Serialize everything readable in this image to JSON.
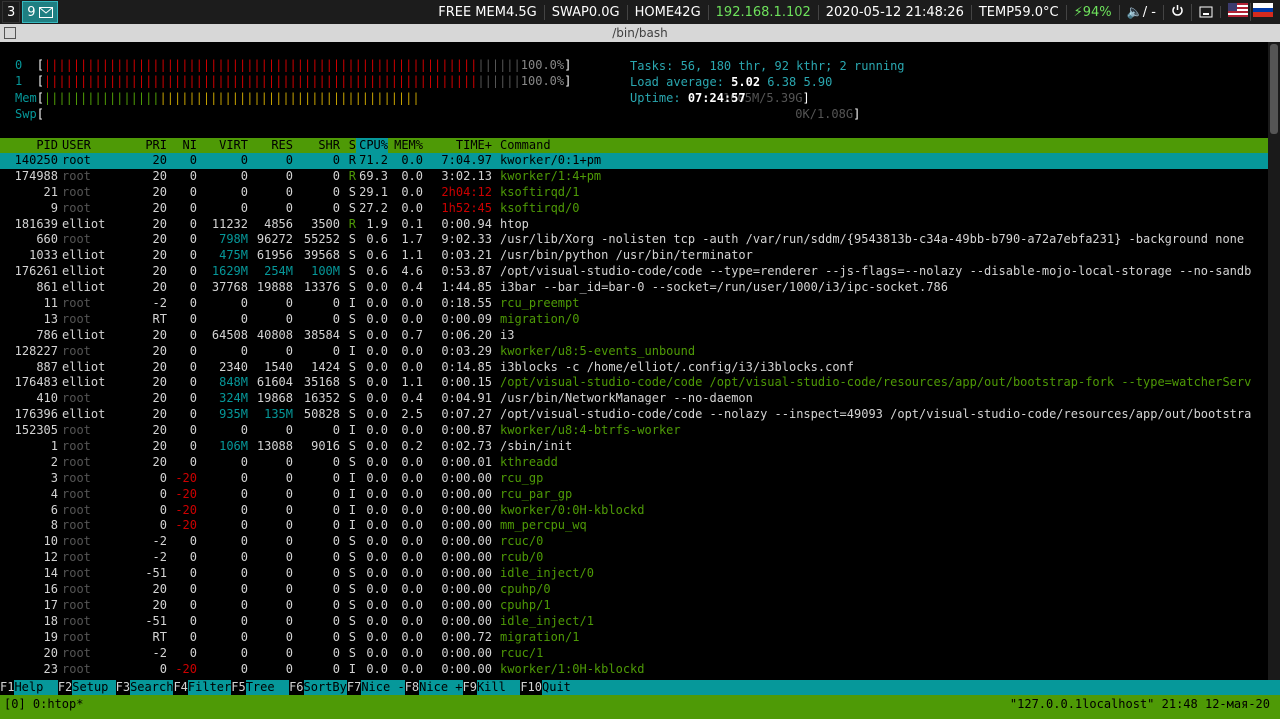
{
  "topbar": {
    "workspaces": [
      {
        "label": "3",
        "active": false
      },
      {
        "label": "9",
        "active": true
      }
    ],
    "blocks": {
      "freemem": "FREE MEM4.5G",
      "swap": "SWAP0.0G",
      "home": "HOME42G",
      "ip": "192.168.1.102",
      "datetime": "2020-05-12 21:48:26",
      "temp": "TEMP59.0°C",
      "battery": "⚡94%",
      "volume": "🔈/ -"
    },
    "colors": {
      "ip": "#6ee25c",
      "battery": "#6ee25c"
    }
  },
  "terminal": {
    "title": "/bin/bash"
  },
  "meters": {
    "cpu0": {
      "label": "0",
      "value": "100.0%"
    },
    "cpu1": {
      "label": "1",
      "value": "100.0%"
    },
    "mem": {
      "label": "Mem",
      "value": "1005M/5.39G"
    },
    "swp": {
      "label": "Swp",
      "value": "0K/1.08G"
    }
  },
  "info": {
    "tasks": "Tasks: 56, 180 thr, 92 kthr; 2 running",
    "load_label": "Load average:",
    "load1": "5.02",
    "load5": "6.38",
    "load15": "5.90",
    "uptime_label": "Uptime:",
    "uptime": "07:24:57"
  },
  "table": {
    "headers": [
      "PID",
      "USER",
      "PRI",
      "NI",
      "VIRT",
      "RES",
      "SHR",
      "S",
      "CPU%",
      "MEM%",
      "TIME+",
      "Command"
    ],
    "rows": [
      {
        "pid": "140250",
        "user": "root",
        "pri": "20",
        "ni": "0",
        "virt": "0",
        "res": "0",
        "shr": "0",
        "s": "R",
        "cpu": "71.2",
        "mem": "0.0",
        "time": "7:04.97",
        "cmd": "kworker/0:1+pm",
        "sel": true,
        "k": true
      },
      {
        "pid": "174988",
        "user": "root",
        "pri": "20",
        "ni": "0",
        "virt": "0",
        "res": "0",
        "shr": "0",
        "s": "R",
        "cpu": "69.3",
        "mem": "0.0",
        "time": "3:02.13",
        "cmd": "kworker/1:4+pm",
        "k": true
      },
      {
        "pid": "21",
        "user": "root",
        "pri": "20",
        "ni": "0",
        "virt": "0",
        "res": "0",
        "shr": "0",
        "s": "S",
        "cpu": "29.1",
        "mem": "0.0",
        "time": "2h04:12",
        "cmd": "ksoftirqd/1",
        "k": true
      },
      {
        "pid": "9",
        "user": "root",
        "pri": "20",
        "ni": "0",
        "virt": "0",
        "res": "0",
        "shr": "0",
        "s": "S",
        "cpu": "27.2",
        "mem": "0.0",
        "time": "1h52:45",
        "cmd": "ksoftirqd/0",
        "k": true
      },
      {
        "pid": "181639",
        "user": "elliot",
        "pri": "20",
        "ni": "0",
        "virt": "11232",
        "res": "4856",
        "shr": "3500",
        "s": "R",
        "cpu": "1.9",
        "mem": "0.1",
        "time": "0:00.94",
        "cmd": "htop"
      },
      {
        "pid": "660",
        "user": "root",
        "pri": "20",
        "ni": "0",
        "virt": "798M",
        "res": "96272",
        "shr": "55252",
        "s": "S",
        "cpu": "0.6",
        "mem": "1.7",
        "time": "9:02.33",
        "cmd": "/usr/lib/Xorg -nolisten tcp -auth /var/run/sddm/{9543813b-c34a-49bb-b790-a72a7ebfa231} -background none"
      },
      {
        "pid": "1033",
        "user": "elliot",
        "pri": "20",
        "ni": "0",
        "virt": "475M",
        "res": "61956",
        "shr": "39568",
        "s": "S",
        "cpu": "0.6",
        "mem": "1.1",
        "time": "0:03.21",
        "cmd": "/usr/bin/python /usr/bin/terminator"
      },
      {
        "pid": "176261",
        "user": "elliot",
        "pri": "20",
        "ni": "0",
        "virt": "1629M",
        "res": "254M",
        "shr": "100M",
        "s": "S",
        "cpu": "0.6",
        "mem": "4.6",
        "time": "0:53.87",
        "cmd": "/opt/visual-studio-code/code --type=renderer --js-flags=--nolazy --disable-mojo-local-storage --no-sandb"
      },
      {
        "pid": "861",
        "user": "elliot",
        "pri": "20",
        "ni": "0",
        "virt": "37768",
        "res": "19888",
        "shr": "13376",
        "s": "S",
        "cpu": "0.0",
        "mem": "0.4",
        "time": "1:44.85",
        "cmd": "i3bar --bar_id=bar-0 --socket=/run/user/1000/i3/ipc-socket.786"
      },
      {
        "pid": "11",
        "user": "root",
        "pri": "-2",
        "ni": "0",
        "virt": "0",
        "res": "0",
        "shr": "0",
        "s": "I",
        "cpu": "0.0",
        "mem": "0.0",
        "time": "0:18.55",
        "cmd": "rcu_preempt",
        "k": true
      },
      {
        "pid": "13",
        "user": "root",
        "pri": "RT",
        "ni": "0",
        "virt": "0",
        "res": "0",
        "shr": "0",
        "s": "S",
        "cpu": "0.0",
        "mem": "0.0",
        "time": "0:00.09",
        "cmd": "migration/0",
        "k": true
      },
      {
        "pid": "786",
        "user": "elliot",
        "pri": "20",
        "ni": "0",
        "virt": "64508",
        "res": "40808",
        "shr": "38584",
        "s": "S",
        "cpu": "0.0",
        "mem": "0.7",
        "time": "0:06.20",
        "cmd": "i3"
      },
      {
        "pid": "128227",
        "user": "root",
        "pri": "20",
        "ni": "0",
        "virt": "0",
        "res": "0",
        "shr": "0",
        "s": "I",
        "cpu": "0.0",
        "mem": "0.0",
        "time": "0:03.29",
        "cmd": "kworker/u8:5-events_unbound",
        "k": true
      },
      {
        "pid": "887",
        "user": "elliot",
        "pri": "20",
        "ni": "0",
        "virt": "2340",
        "res": "1540",
        "shr": "1424",
        "s": "S",
        "cpu": "0.0",
        "mem": "0.0",
        "time": "0:14.85",
        "cmd": "i3blocks -c /home/elliot/.config/i3/i3blocks.conf"
      },
      {
        "pid": "176483",
        "user": "elliot",
        "pri": "20",
        "ni": "0",
        "virt": "848M",
        "res": "61604",
        "shr": "35168",
        "s": "S",
        "cpu": "0.0",
        "mem": "1.1",
        "time": "0:00.15",
        "cmd": "/opt/visual-studio-code/code /opt/visual-studio-code/resources/app/out/bootstrap-fork --type=watcherServ",
        "k": true
      },
      {
        "pid": "410",
        "user": "root",
        "pri": "20",
        "ni": "0",
        "virt": "324M",
        "res": "19868",
        "shr": "16352",
        "s": "S",
        "cpu": "0.0",
        "mem": "0.4",
        "time": "0:04.91",
        "cmd": "/usr/bin/NetworkManager --no-daemon"
      },
      {
        "pid": "176396",
        "user": "elliot",
        "pri": "20",
        "ni": "0",
        "virt": "935M",
        "res": "135M",
        "shr": "50828",
        "s": "S",
        "cpu": "0.0",
        "mem": "2.5",
        "time": "0:07.27",
        "cmd": "/opt/visual-studio-code/code --nolazy --inspect=49093 /opt/visual-studio-code/resources/app/out/bootstra"
      },
      {
        "pid": "152305",
        "user": "root",
        "pri": "20",
        "ni": "0",
        "virt": "0",
        "res": "0",
        "shr": "0",
        "s": "I",
        "cpu": "0.0",
        "mem": "0.0",
        "time": "0:00.87",
        "cmd": "kworker/u8:4-btrfs-worker",
        "k": true
      },
      {
        "pid": "1",
        "user": "root",
        "pri": "20",
        "ni": "0",
        "virt": "106M",
        "res": "13088",
        "shr": "9016",
        "s": "S",
        "cpu": "0.0",
        "mem": "0.2",
        "time": "0:02.73",
        "cmd": "/sbin/init"
      },
      {
        "pid": "2",
        "user": "root",
        "pri": "20",
        "ni": "0",
        "virt": "0",
        "res": "0",
        "shr": "0",
        "s": "S",
        "cpu": "0.0",
        "mem": "0.0",
        "time": "0:00.01",
        "cmd": "kthreadd",
        "k": true
      },
      {
        "pid": "3",
        "user": "root",
        "pri": "0",
        "ni": "-20",
        "virt": "0",
        "res": "0",
        "shr": "0",
        "s": "I",
        "cpu": "0.0",
        "mem": "0.0",
        "time": "0:00.00",
        "cmd": "rcu_gp",
        "k": true
      },
      {
        "pid": "4",
        "user": "root",
        "pri": "0",
        "ni": "-20",
        "virt": "0",
        "res": "0",
        "shr": "0",
        "s": "I",
        "cpu": "0.0",
        "mem": "0.0",
        "time": "0:00.00",
        "cmd": "rcu_par_gp",
        "k": true
      },
      {
        "pid": "6",
        "user": "root",
        "pri": "0",
        "ni": "-20",
        "virt": "0",
        "res": "0",
        "shr": "0",
        "s": "I",
        "cpu": "0.0",
        "mem": "0.0",
        "time": "0:00.00",
        "cmd": "kworker/0:0H-kblockd",
        "k": true
      },
      {
        "pid": "8",
        "user": "root",
        "pri": "0",
        "ni": "-20",
        "virt": "0",
        "res": "0",
        "shr": "0",
        "s": "I",
        "cpu": "0.0",
        "mem": "0.0",
        "time": "0:00.00",
        "cmd": "mm_percpu_wq",
        "k": true
      },
      {
        "pid": "10",
        "user": "root",
        "pri": "-2",
        "ni": "0",
        "virt": "0",
        "res": "0",
        "shr": "0",
        "s": "S",
        "cpu": "0.0",
        "mem": "0.0",
        "time": "0:00.00",
        "cmd": "rcuc/0",
        "k": true
      },
      {
        "pid": "12",
        "user": "root",
        "pri": "-2",
        "ni": "0",
        "virt": "0",
        "res": "0",
        "shr": "0",
        "s": "S",
        "cpu": "0.0",
        "mem": "0.0",
        "time": "0:00.00",
        "cmd": "rcub/0",
        "k": true
      },
      {
        "pid": "14",
        "user": "root",
        "pri": "-51",
        "ni": "0",
        "virt": "0",
        "res": "0",
        "shr": "0",
        "s": "S",
        "cpu": "0.0",
        "mem": "0.0",
        "time": "0:00.00",
        "cmd": "idle_inject/0",
        "k": true
      },
      {
        "pid": "16",
        "user": "root",
        "pri": "20",
        "ni": "0",
        "virt": "0",
        "res": "0",
        "shr": "0",
        "s": "S",
        "cpu": "0.0",
        "mem": "0.0",
        "time": "0:00.00",
        "cmd": "cpuhp/0",
        "k": true
      },
      {
        "pid": "17",
        "user": "root",
        "pri": "20",
        "ni": "0",
        "virt": "0",
        "res": "0",
        "shr": "0",
        "s": "S",
        "cpu": "0.0",
        "mem": "0.0",
        "time": "0:00.00",
        "cmd": "cpuhp/1",
        "k": true
      },
      {
        "pid": "18",
        "user": "root",
        "pri": "-51",
        "ni": "0",
        "virt": "0",
        "res": "0",
        "shr": "0",
        "s": "S",
        "cpu": "0.0",
        "mem": "0.0",
        "time": "0:00.00",
        "cmd": "idle_inject/1",
        "k": true
      },
      {
        "pid": "19",
        "user": "root",
        "pri": "RT",
        "ni": "0",
        "virt": "0",
        "res": "0",
        "shr": "0",
        "s": "S",
        "cpu": "0.0",
        "mem": "0.0",
        "time": "0:00.72",
        "cmd": "migration/1",
        "k": true
      },
      {
        "pid": "20",
        "user": "root",
        "pri": "-2",
        "ni": "0",
        "virt": "0",
        "res": "0",
        "shr": "0",
        "s": "S",
        "cpu": "0.0",
        "mem": "0.0",
        "time": "0:00.00",
        "cmd": "rcuc/1",
        "k": true
      },
      {
        "pid": "23",
        "user": "root",
        "pri": "0",
        "ni": "-20",
        "virt": "0",
        "res": "0",
        "shr": "0",
        "s": "I",
        "cpu": "0.0",
        "mem": "0.0",
        "time": "0:00.00",
        "cmd": "kworker/1:0H-kblockd",
        "k": true
      }
    ]
  },
  "fkeys": [
    {
      "key": "F1",
      "label": "Help  "
    },
    {
      "key": "F2",
      "label": "Setup "
    },
    {
      "key": "F3",
      "label": "Search"
    },
    {
      "key": "F4",
      "label": "Filter"
    },
    {
      "key": "F5",
      "label": "Tree  "
    },
    {
      "key": "F6",
      "label": "SortBy"
    },
    {
      "key": "F7",
      "label": "Nice -"
    },
    {
      "key": "F8",
      "label": "Nice +"
    },
    {
      "key": "F9",
      "label": "Kill  "
    },
    {
      "key": "F10",
      "label": "Quit"
    }
  ],
  "tmux": {
    "left": "[0] 0:htop*",
    "right": "\"127.0.0.1localhost\" 21:48 12-мая-20"
  }
}
